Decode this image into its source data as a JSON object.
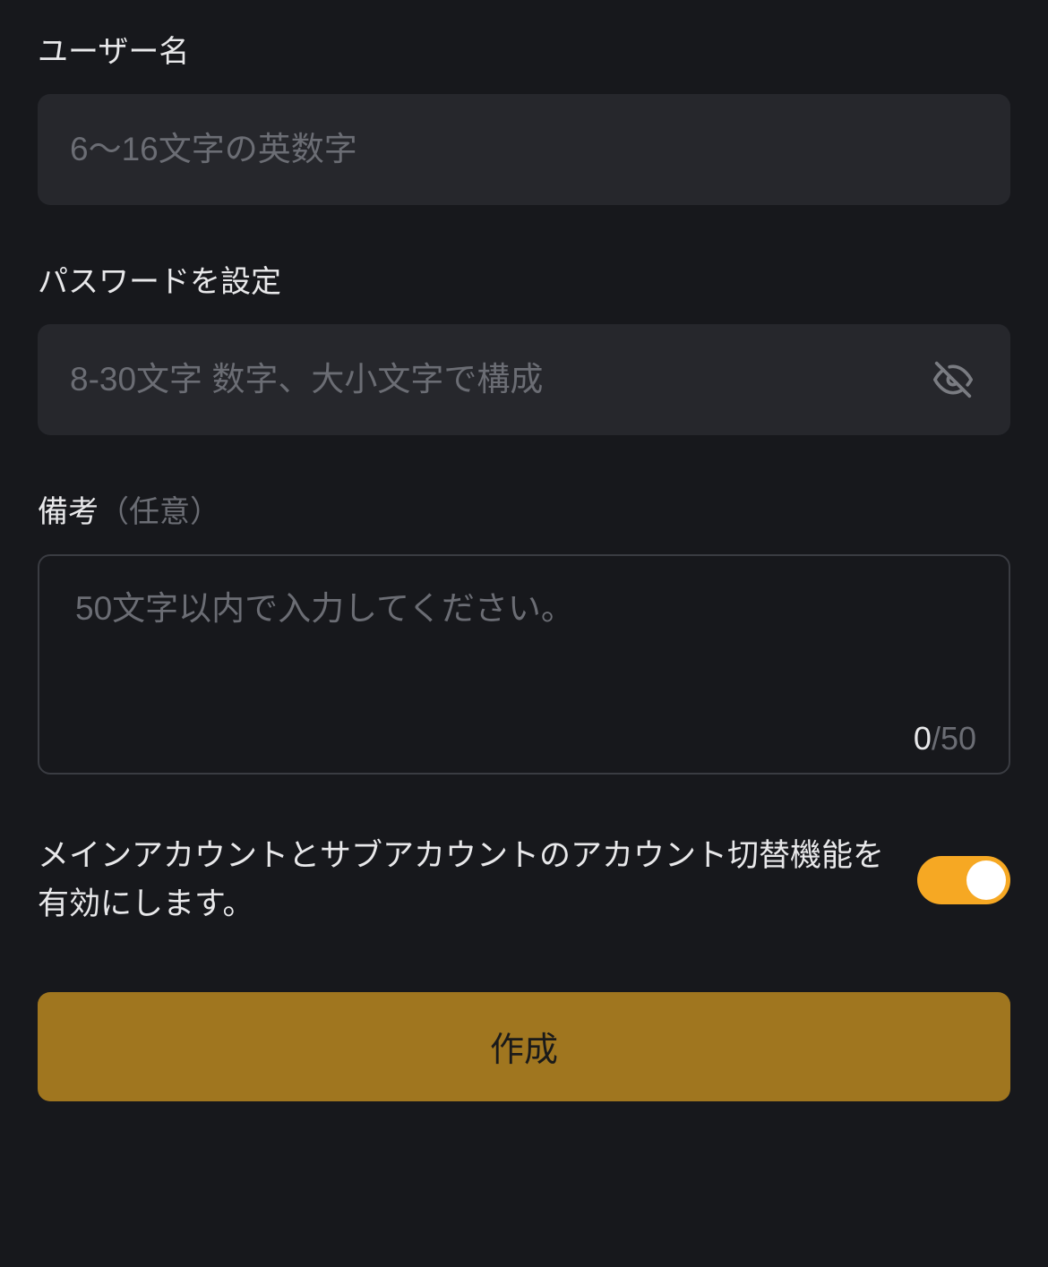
{
  "username": {
    "label": "ユーザー名",
    "placeholder": "6〜16文字の英数字",
    "value": ""
  },
  "password": {
    "label": "パスワードを設定",
    "placeholder": "8-30文字 数字、大小文字で構成",
    "value": ""
  },
  "notes": {
    "label": "備考",
    "optional_hint": "（任意）",
    "placeholder": "50文字以内で入力してください。",
    "value": "",
    "count": "0",
    "max": "/50"
  },
  "toggle": {
    "label": "メインアカウントとサブアカウントのアカウント切替機能を有効にします。",
    "enabled": true
  },
  "create_button": {
    "label": "作成"
  }
}
